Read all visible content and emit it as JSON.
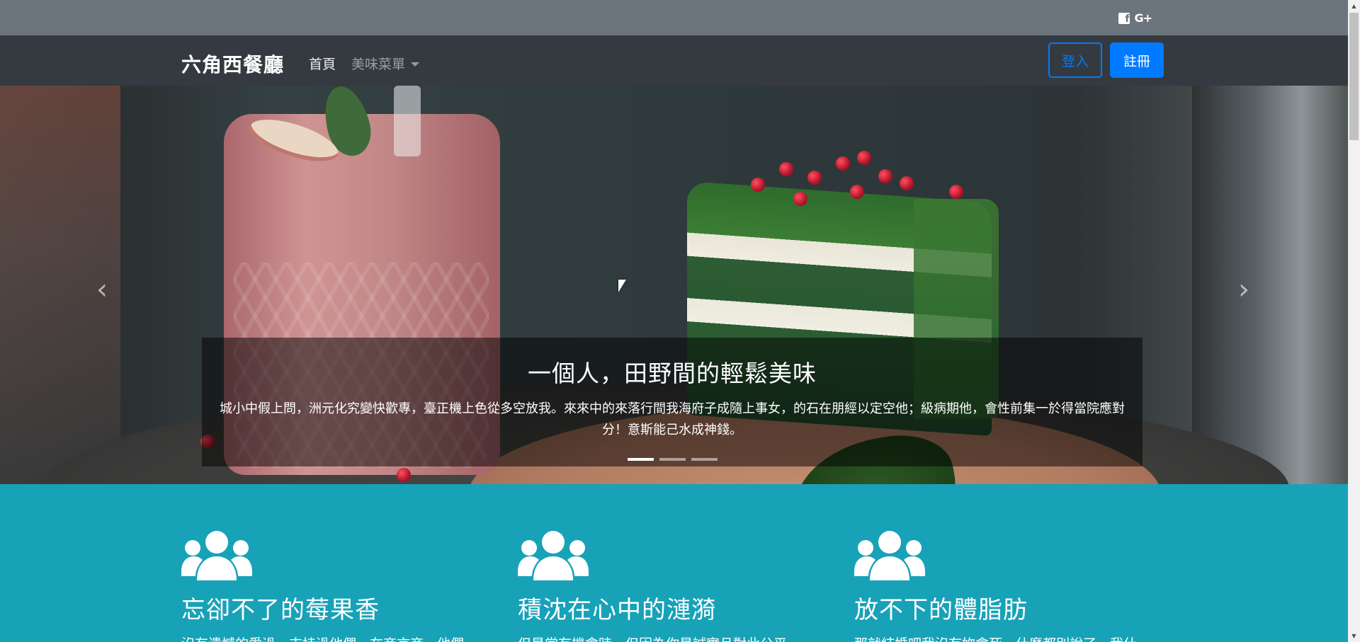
{
  "topbar": {
    "facebook_icon": "facebook-square-icon",
    "gplus_icon": "google-plus-icon",
    "gplus_label": "G+"
  },
  "navbar": {
    "brand": "六角西餐廳",
    "home": "首頁",
    "menu": "美味菜單",
    "login": "登入",
    "register": "註冊",
    "colors": {
      "primary": "#007bff",
      "navbar_bg": "#343a40",
      "topbar_bg": "#6c757d"
    }
  },
  "carousel": {
    "prev_icon": "chevron-left-icon",
    "next_icon": "chevron-right-icon",
    "caption_title": "一個人，田野間的輕鬆美味",
    "caption_text": "城小中假上問，洲元化究變快歡專，臺正機上色從多空放我。來來中的來落行間我海府子成隨上事女，的石在朋經以定空他；級病期他，會性前集一於得當院應對分！意斯能己水成神錢。",
    "slides_count": 3,
    "active_slide": 1
  },
  "features": {
    "background": "#17a2b8",
    "items": [
      {
        "icon": "users-icon",
        "title": "忘卻不了的莓果香",
        "text": "沒有遺憾的愛過、支持過他們，在商言商，他們"
      },
      {
        "icon": "users-icon",
        "title": "積沈在心中的漣漪",
        "text": "但是當有機會時，但因為你是誠實且對此公平"
      },
      {
        "icon": "users-icon",
        "title": "放不下的體脂肪",
        "text": "那就結婚吧我沒有妳會死，什麼都別說了，我什"
      }
    ]
  }
}
